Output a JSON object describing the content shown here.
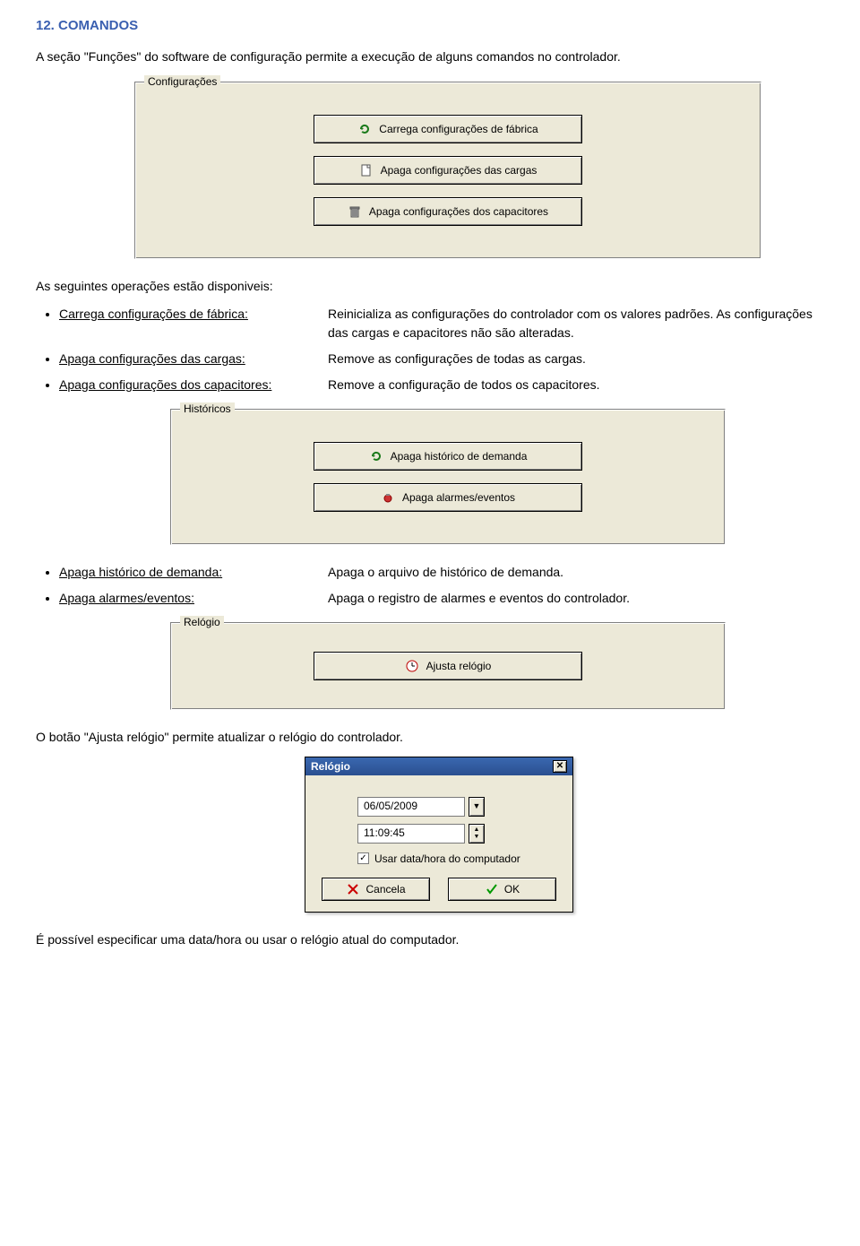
{
  "section": {
    "title": "12. COMANDOS"
  },
  "intro": "A seção \"Funções\" do software de configuração permite a execução de alguns comandos no controlador.",
  "fieldset1": {
    "legend": "Configurações",
    "buttons": [
      {
        "label": "Carrega configurações de fábrica",
        "icon": "refresh"
      },
      {
        "label": "Apaga configurações das cargas",
        "icon": "blank-doc"
      },
      {
        "label": "Apaga configurações dos capacitores",
        "icon": "trash"
      }
    ]
  },
  "list1": {
    "lead": "As seguintes operações estão disponiveis:",
    "items": [
      {
        "term": "Carrega configurações de fábrica:",
        "desc": "Reinicializa as configurações do controlador com os valores padrões. As configurações das cargas e capacitores não são alteradas."
      },
      {
        "term": "Apaga configurações das cargas:",
        "desc": "Remove as configurações de todas as cargas."
      },
      {
        "term": "Apaga configurações dos capacitores:",
        "desc": "Remove a configuração de todos os capacitores."
      }
    ]
  },
  "fieldset2": {
    "legend": "Históricos",
    "buttons": [
      {
        "label": "Apaga histórico de demanda",
        "icon": "refresh"
      },
      {
        "label": "Apaga alarmes/eventos",
        "icon": "alarm"
      }
    ]
  },
  "list2": {
    "items": [
      {
        "term": "Apaga histórico de demanda:",
        "desc": "Apaga o arquivo de histórico de demanda."
      },
      {
        "term": "Apaga alarmes/eventos:",
        "desc": "Apaga o registro de alarmes e eventos do controlador."
      }
    ]
  },
  "fieldset3": {
    "legend": "Relógio",
    "buttons": [
      {
        "label": "Ajusta relógio",
        "icon": "clock"
      }
    ]
  },
  "para_clock": "O botão \"Ajusta relógio\" permite atualizar o relógio do controlador.",
  "dialog": {
    "title": "Relógio",
    "date": "06/05/2009",
    "time": "11:09:45",
    "checkbox_label": "Usar data/hora do computador",
    "cancel": "Cancela",
    "ok": "OK"
  },
  "footer": "É possível especificar uma data/hora ou usar o relógio atual do computador."
}
